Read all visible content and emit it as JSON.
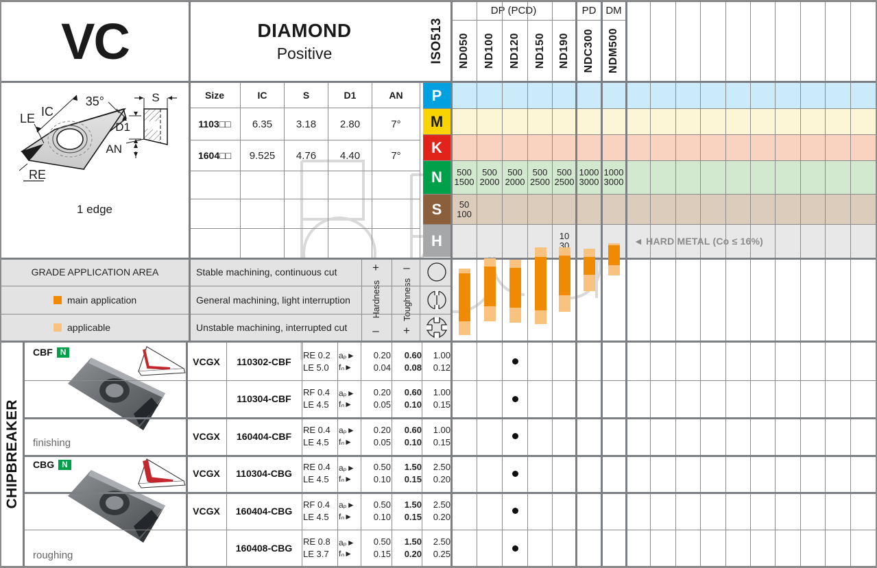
{
  "header": {
    "family_code": "VC",
    "shape_name": "DIAMOND",
    "shape_type": "Positive",
    "iso_label": "ISO513",
    "groups": [
      {
        "label": "DP (PCD)",
        "span": 5
      },
      {
        "label": "PD",
        "span": 1
      },
      {
        "label": "DM",
        "span": 1
      }
    ],
    "grades": [
      "ND050",
      "ND100",
      "ND120",
      "ND150",
      "ND190",
      "NDC300",
      "NDM500"
    ]
  },
  "drawing": {
    "labels": [
      "IC",
      "LE",
      "RE",
      "AN",
      "D1",
      "S",
      "35°"
    ],
    "edges_note": "1 edge"
  },
  "dimensions": {
    "columns": [
      "Size",
      "IC",
      "S",
      "D1",
      "AN"
    ],
    "rows": [
      {
        "size": "1103□□",
        "ic": "6.35",
        "s": "3.18",
        "d1": "2.80",
        "an": "7°"
      },
      {
        "size": "1604□□",
        "ic": "9.525",
        "s": "4.76",
        "d1": "4.40",
        "an": "7°"
      },
      {
        "size": "",
        "ic": "",
        "s": "",
        "d1": "",
        "an": ""
      },
      {
        "size": "",
        "ic": "",
        "s": "",
        "d1": "",
        "an": ""
      },
      {
        "size": "",
        "ic": "",
        "s": "",
        "d1": "",
        "an": ""
      }
    ]
  },
  "iso_rows": [
    {
      "letter": "P",
      "values": [
        "",
        "",
        "",
        "",
        "",
        "",
        ""
      ]
    },
    {
      "letter": "M",
      "values": [
        "",
        "",
        "",
        "",
        "",
        "",
        ""
      ]
    },
    {
      "letter": "K",
      "values": [
        "",
        "",
        "",
        "",
        "",
        "",
        ""
      ]
    },
    {
      "letter": "N",
      "values": [
        "500\n1500",
        "500\n2000",
        "500\n2000",
        "500\n2500",
        "500\n2500",
        "1000\n3000",
        "1000\n3000"
      ]
    },
    {
      "letter": "S",
      "values": [
        "50\n100",
        "",
        "",
        "",
        "",
        "",
        ""
      ]
    },
    {
      "letter": "H",
      "values": [
        "",
        "",
        "",
        "",
        "10\n30",
        "",
        ""
      ]
    }
  ],
  "hard_metal_note": "◄ HARD METAL (Co ≤ 16%)",
  "grade_application": {
    "title": "GRADE APPLICATION AREA",
    "legend": [
      {
        "label": "main application",
        "color": "#F08A00"
      },
      {
        "label": "applicable",
        "color": "#F9C27E"
      }
    ],
    "conditions": [
      "Stable machining, continuous cut",
      "General machining, light interruption",
      "Unstable machining, interrupted cut"
    ],
    "axis": {
      "hardness_label": "Hardness",
      "hardness_top": "+",
      "hardness_bottom": "–",
      "toughness_label": "Toughness",
      "toughness_top": "–",
      "toughness_bottom": "+"
    },
    "bars": [
      {
        "grade": "ND050",
        "app_top": 0.38,
        "main_top": 0.55,
        "main_bottom": 2.3,
        "app_bottom": 2.8
      },
      {
        "grade": "ND100",
        "app_top": 0.0,
        "main_top": 0.3,
        "main_bottom": 1.75,
        "app_bottom": 2.3
      },
      {
        "grade": "ND120",
        "app_top": 0.05,
        "main_top": 0.35,
        "main_bottom": 1.8,
        "app_bottom": 2.35
      },
      {
        "grade": "ND150",
        "app_top": -0.4,
        "main_top": -0.05,
        "main_bottom": 1.9,
        "app_bottom": 2.4
      },
      {
        "grade": "ND190",
        "app_top": -0.4,
        "main_top": -0.1,
        "main_bottom": 1.35,
        "app_bottom": 1.95
      },
      {
        "grade": "NDC300",
        "app_top": -0.35,
        "main_top": -0.05,
        "main_bottom": 0.6,
        "app_bottom": 1.2
      },
      {
        "grade": "NDM500",
        "app_top": -0.55,
        "main_top": -0.48,
        "main_bottom": 0.25,
        "app_bottom": 0.62
      }
    ]
  },
  "chipbreakers": [
    {
      "code": "CBF",
      "iso_badge": "N",
      "use": "finishing",
      "rows": [
        {
          "series": "VCGX",
          "designation": "110302-CBF",
          "re": "RE 0.2",
          "le": "LE 5.0",
          "ap_label": "aₚ",
          "fn_label": "fₙ",
          "ap": [
            "0.20",
            "0.60",
            "1.00"
          ],
          "fn": [
            "0.04",
            "0.08",
            "0.12"
          ],
          "grade_dot": "ND120"
        },
        {
          "series": "",
          "designation": "110304-CBF",
          "re": "RF 0.4",
          "le": "LE 4.5",
          "ap_label": "aₚ",
          "fn_label": "fₙ",
          "ap": [
            "0.20",
            "0.60",
            "1.00"
          ],
          "fn": [
            "0.05",
            "0.10",
            "0.15"
          ],
          "grade_dot": "ND120"
        },
        {
          "series": "VCGX",
          "designation": "160404-CBF",
          "re": "RE 0.4",
          "le": "LE 4.5",
          "ap_label": "aₚ",
          "fn_label": "fₙ",
          "ap": [
            "0.20",
            "0.60",
            "1.00"
          ],
          "fn": [
            "0.05",
            "0.10",
            "0.15"
          ],
          "grade_dot": "ND120"
        }
      ]
    },
    {
      "code": "CBG",
      "iso_badge": "N",
      "use": "roughing",
      "rows": [
        {
          "series": "VCGX",
          "designation": "110304-CBG",
          "re": "RE 0.4",
          "le": "LE 4.5",
          "ap_label": "aₚ",
          "fn_label": "fₙ",
          "ap": [
            "0.50",
            "1.50",
            "2.50"
          ],
          "fn": [
            "0.10",
            "0.15",
            "0.20"
          ],
          "grade_dot": "ND120"
        },
        {
          "series": "VCGX",
          "designation": "160404-CBG",
          "re": "RF 0.4",
          "le": "LE 4.5",
          "ap_label": "aₚ",
          "fn_label": "fₙ",
          "ap": [
            "0.50",
            "1.50",
            "2.50"
          ],
          "fn": [
            "0.10",
            "0.15",
            "0.20"
          ],
          "grade_dot": "ND120"
        },
        {
          "series": "",
          "designation": "160408-CBG",
          "re": "RE 0.8",
          "le": "LE 3.7",
          "ap_label": "aₚ",
          "fn_label": "fₙ",
          "ap": [
            "0.50",
            "1.50",
            "2.50"
          ],
          "fn": [
            "0.15",
            "0.20",
            "0.25"
          ],
          "grade_dot": "ND120"
        }
      ]
    }
  ],
  "sidebar_label": "CHIPBREAKER",
  "colors": {
    "P": "#00A0E1",
    "M": "#FAD400",
    "K": "#E2231A",
    "N": "#00A04A",
    "S": "#8B5E3C",
    "H": "#A5A7A9",
    "main_application": "#F08A00",
    "applicable": "#F9C27E",
    "grid": "#8b8b8b",
    "thick_grid": "#7b7f83"
  }
}
